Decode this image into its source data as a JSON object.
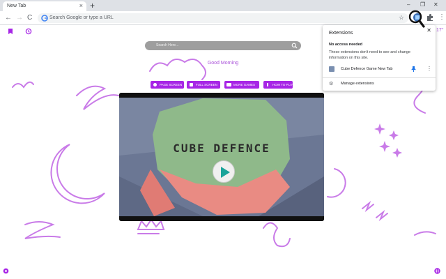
{
  "browser": {
    "tab_title": "New Tab",
    "tab_close": "×",
    "new_tab": "+",
    "win_min": "–",
    "win_max": "❐",
    "win_close": "✕",
    "back": "←",
    "forward": "→",
    "reload": "C",
    "omnibox_placeholder": "Search Google or type a URL",
    "star": "☆",
    "menu": "⋮"
  },
  "page": {
    "search_placeholder": "Search Here...",
    "greeting": "Good Morning",
    "temperature": "17°",
    "buttons": [
      {
        "label": "PAGE SCREEN",
        "icon": "bulb-icon"
      },
      {
        "label": "FULL SCREEN",
        "icon": "fullscreen-icon"
      },
      {
        "label": "MORE GAMES",
        "icon": "gamepad-icon"
      },
      {
        "label": "HOW TO PLAY",
        "icon": "info-icon"
      }
    ],
    "game_title": "CUBE DEFENCE",
    "accent_color": "#a726e6",
    "doodle_color": "#c97be8"
  },
  "extensions_popup": {
    "title": "Extensions",
    "close": "✕",
    "heading": "No access needed",
    "description": "These extensions don't need to see and change information on this site.",
    "items": [
      {
        "name": "Cube Defence Game New Tab",
        "pinned": true
      }
    ],
    "manage_label": "Manage extensions"
  }
}
